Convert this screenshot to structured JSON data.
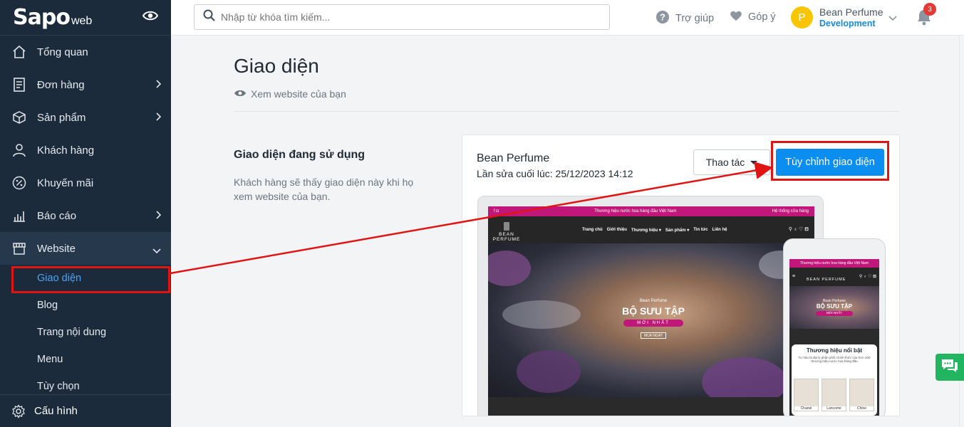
{
  "sidebar": {
    "logo": {
      "main": "Sapo",
      "sub": "web"
    },
    "items": [
      {
        "label": "Tổng quan",
        "icon": "home-icon",
        "has_children": false
      },
      {
        "label": "Đơn hàng",
        "icon": "order-icon",
        "has_children": true
      },
      {
        "label": "Sản phẩm",
        "icon": "box-icon",
        "has_children": true
      },
      {
        "label": "Khách hàng",
        "icon": "user-icon",
        "has_children": false
      },
      {
        "label": "Khuyến mãi",
        "icon": "percent-icon",
        "has_children": false
      },
      {
        "label": "Báo cáo",
        "icon": "chart-icon",
        "has_children": true
      },
      {
        "label": "Website",
        "icon": "store-icon",
        "has_children": true,
        "expanded": true
      }
    ],
    "website_sub": [
      "Giao diện",
      "Blog",
      "Trang nội dung",
      "Menu",
      "Tùy chọn"
    ],
    "settings_label": "Cấu hình"
  },
  "topbar": {
    "search_placeholder": "Nhập từ khóa tìm kiếm...",
    "help_label": "Trợ giúp",
    "feedback_label": "Góp ý",
    "avatar_letter": "P",
    "account_name": "Bean Perfume",
    "account_role": "Development",
    "notification_count": "3"
  },
  "main": {
    "title": "Giao diện",
    "view_site": "Xem website của bạn",
    "section_title": "Giao diện đang sử dụng",
    "section_desc": "Khách hàng sẽ thấy giao diện này khi họ xem website của bạn.",
    "theme": {
      "name": "Bean Perfume",
      "last_edit": "Lần sửa cuối lúc: 25/12/2023 14:12",
      "actions_label": "Thao tác",
      "customize_label": "Tùy chỉnh giao diện"
    }
  },
  "preview": {
    "topbar_text": "Thương hiệu nước hoa hàng đầu Việt Nam",
    "topbar_right": "Hệ thống cửa hàng",
    "logo": "BEAN PERFUME",
    "menu": [
      "Trang chủ",
      "Giới thiệu",
      "Thương hiệu ▾",
      "Sản phẩm ▾",
      "Tin tức",
      "Liên hệ"
    ],
    "hero_brand": "Bean Perfume",
    "hero_title": "BỘ SƯU TẬP",
    "hero_new": "MỚI NHẤT",
    "hero_button": "MUA NGAY",
    "mobile_section_title": "Thương hiệu nổi bật",
    "mobile_section_sub": "Tự hào là đại lý phân phối chính thức của hơn 100 thương hiệu nước hoa hàng đầu",
    "mobile_brands": [
      "Chanel",
      "Lancome",
      "Chloe"
    ]
  },
  "colors": {
    "sidebar_bg": "#1b2b3c",
    "primary_button": "#0b8ef0",
    "active_link": "#4fa3f0",
    "annotation_red": "#e11414",
    "brand_magenta": "#c2177a"
  }
}
